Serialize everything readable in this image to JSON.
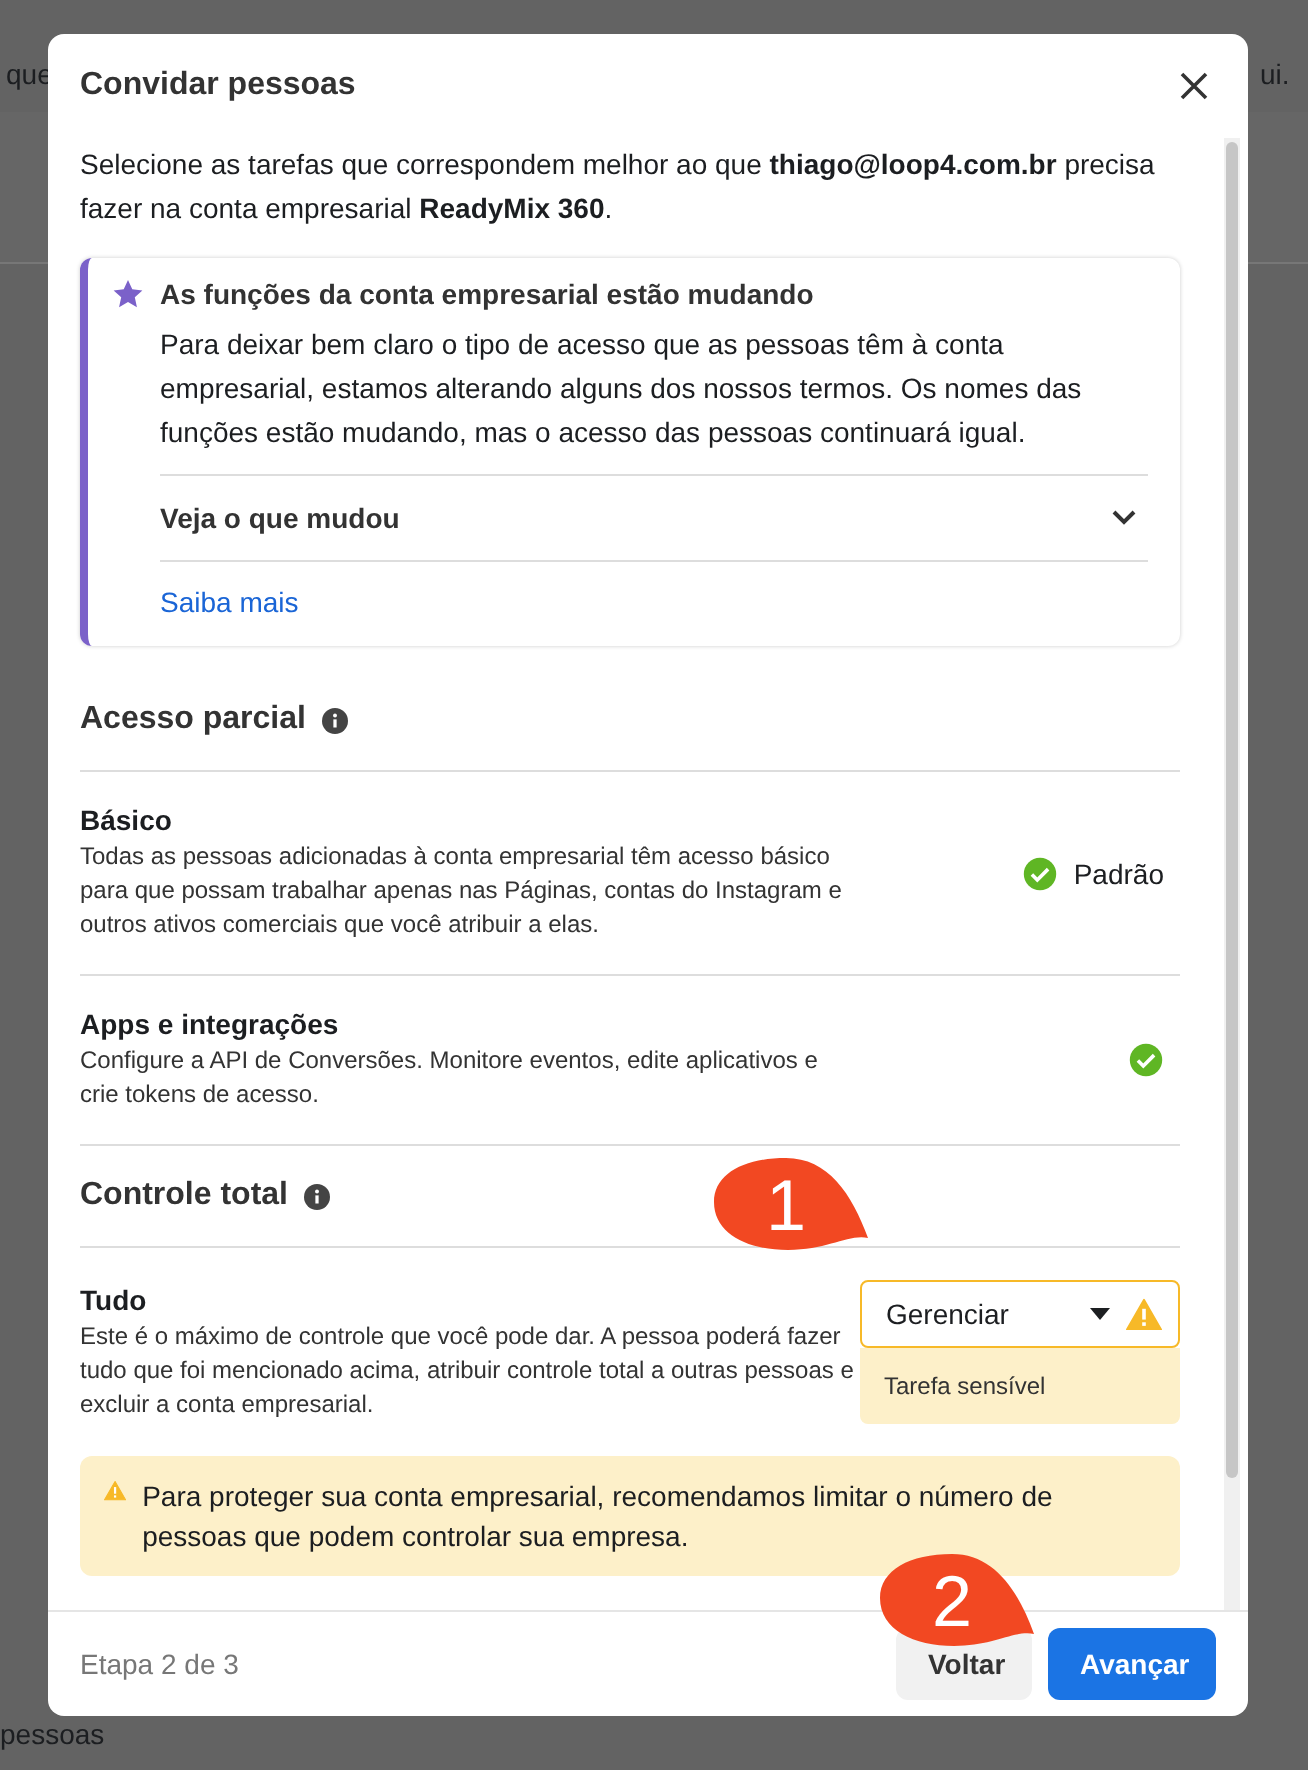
{
  "background": {
    "texts": [
      "que",
      "ui.",
      "pessoas"
    ]
  },
  "dialog": {
    "title": "Convidar pessoas",
    "intro": "Selecione as tarefas que correspondem melhor ao que **thiago@loop4.com.br** precisa fazer na conta empresarial **ReadyMix 360**.",
    "notice": {
      "title": "As funções da conta empresarial estão mudando",
      "body": "Para deixar bem claro o tipo de acesso que as pessoas têm à conta empresarial, estamos alterando alguns dos nossos termos. Os nomes das funções estão mudando, mas o acesso das pessoas continuará igual.",
      "expander": {
        "label": "Veja o que mudou",
        "expanded": false
      },
      "link": "Saiba mais"
    },
    "sections": [
      {
        "title": "Acesso parcial",
        "rows": [
          {
            "kind": "included",
            "title": "Básico",
            "description": "Todas as pessoas adicionadas à conta empresarial têm acesso básico para que possam trabalhar apenas nas Páginas, contas do Instagram e outros ativos comerciais que você atribuir a elas.",
            "status": "Padrão"
          },
          {
            "kind": "included",
            "title": "Apps e integrações",
            "description": "Configure a API de Conversões. Monitore eventos, edite aplicativos e crie tokens de acesso."
          }
        ]
      },
      {
        "title": "Controle total",
        "rows": [
          {
            "kind": "select",
            "title": "Tudo",
            "description": "Este é o máximo de controle que você pode dar. A pessoa poderá fazer tudo que foi mencionado acima, atribuir controle total a outras pessoas e excluir a conta empresarial.",
            "value": "Gerenciar",
            "note": "Tarefa sensível"
          }
        ]
      }
    ],
    "warning": "Para proteger sua conta empresarial, recomendamos limitar o número de pessoas que podem controlar sua empresa.",
    "footer": {
      "step": "Etapa 2 de 3",
      "buttons": [
        {
          "label": "Voltar",
          "kind": "secondary"
        },
        {
          "label": "Avançar",
          "kind": "primary"
        }
      ]
    }
  },
  "annotations": [
    {
      "label": "1"
    },
    {
      "label": "2"
    }
  ]
}
